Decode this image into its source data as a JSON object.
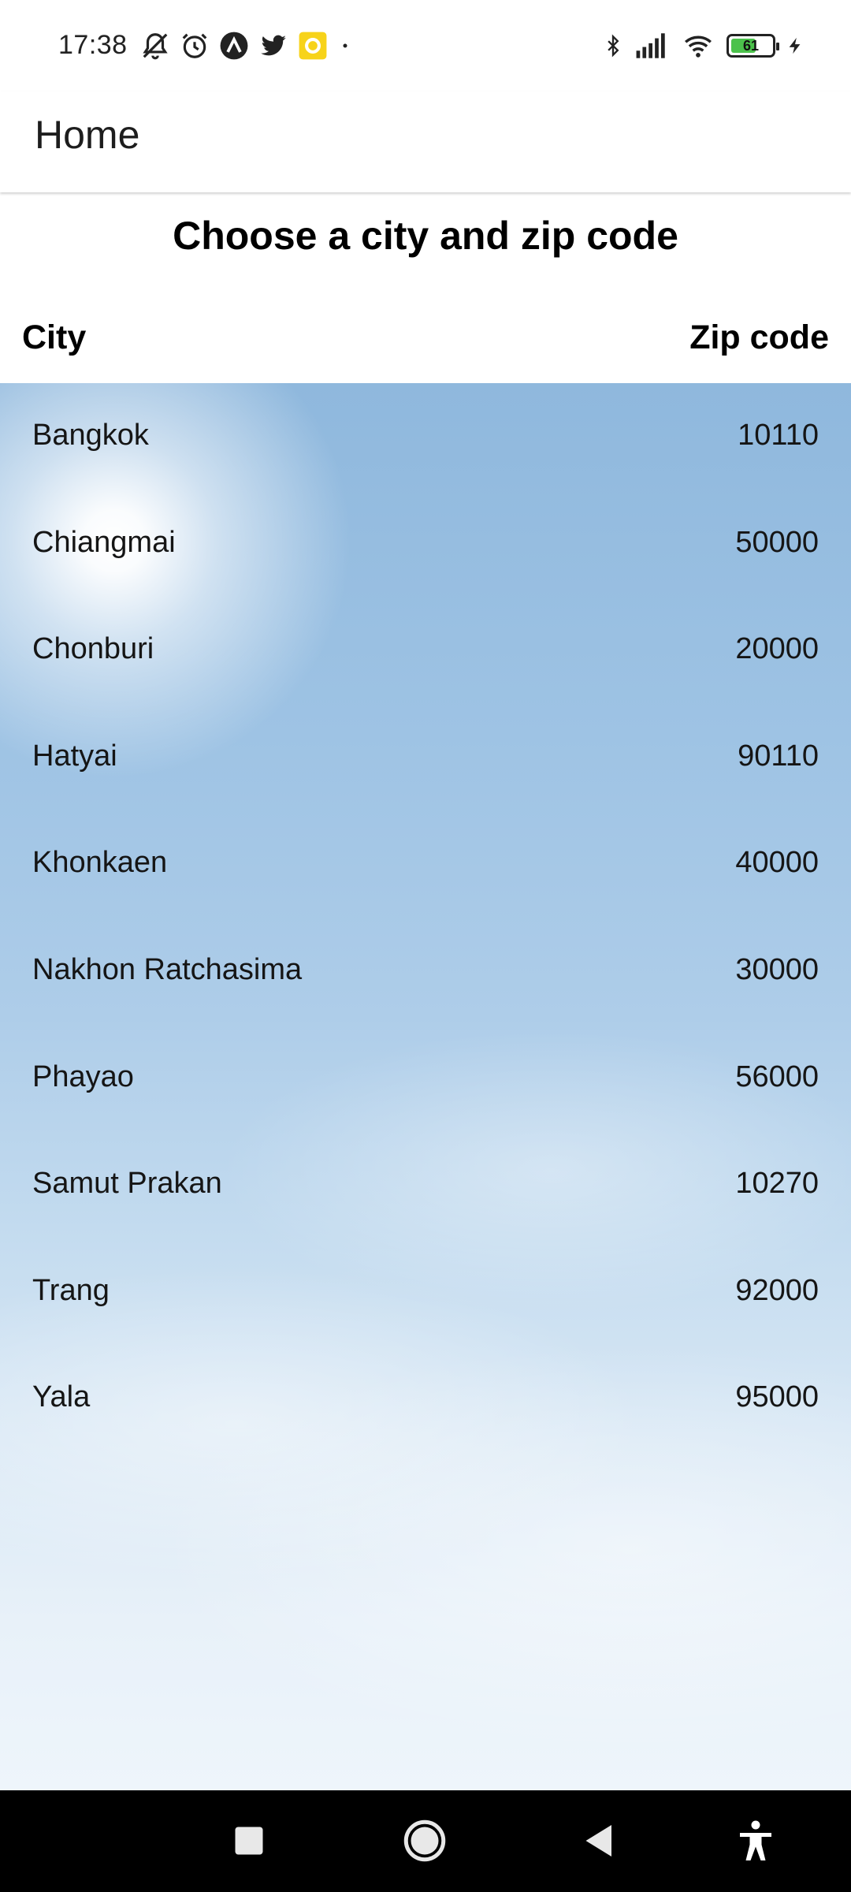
{
  "status_bar": {
    "time": "17:38",
    "battery_level": 61,
    "battery_label": "61",
    "left_icons": [
      "muted-bell-icon",
      "alarm-icon",
      "app-a-icon",
      "twitter-icon",
      "yellow-app-icon",
      "dot-icon"
    ],
    "right_icons": [
      "bluetooth-icon",
      "signal-icon",
      "wifi-icon",
      "battery-icon",
      "charging-icon"
    ]
  },
  "app_bar": {
    "title": "Home"
  },
  "main": {
    "heading": "Choose a city and zip code",
    "column_headers": {
      "city": "City",
      "zip": "Zip code"
    },
    "rows": [
      {
        "city": "Bangkok",
        "zip": "10110"
      },
      {
        "city": "Chiangmai",
        "zip": "50000"
      },
      {
        "city": "Chonburi",
        "zip": "20000"
      },
      {
        "city": "Hatyai",
        "zip": "90110"
      },
      {
        "city": "Khonkaen",
        "zip": "40000"
      },
      {
        "city": "Nakhon Ratchasima",
        "zip": "30000"
      },
      {
        "city": "Phayao",
        "zip": "56000"
      },
      {
        "city": "Samut Prakan",
        "zip": "10270"
      },
      {
        "city": "Trang",
        "zip": "92000"
      },
      {
        "city": "Yala",
        "zip": "95000"
      }
    ]
  },
  "nav_bar": {
    "buttons": [
      "recents-square-icon",
      "home-circle-icon",
      "back-triangle-icon",
      "accessibility-icon"
    ]
  },
  "colors": {
    "sky_top": "#8fb8dd",
    "sky_bottom": "#eef5fb",
    "battery_green": "#4cc24c",
    "nav_bar": "#000000"
  }
}
